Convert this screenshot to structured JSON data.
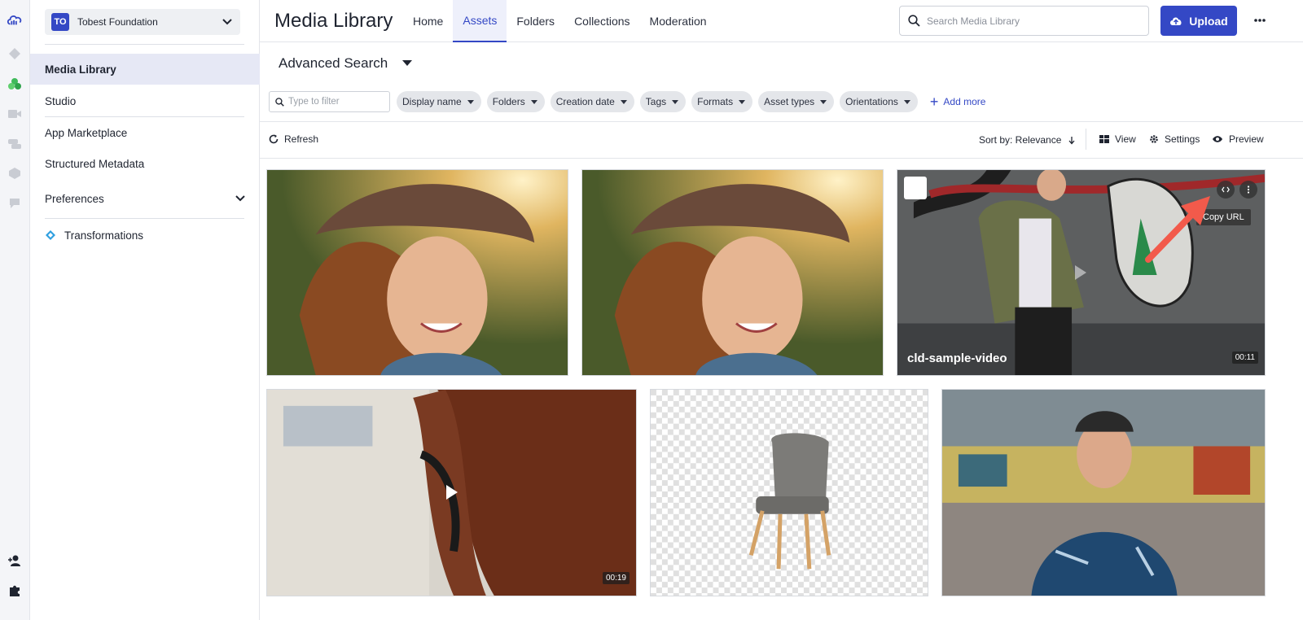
{
  "org": {
    "initials": "TO",
    "name": "Tobest Foundation"
  },
  "sidebar": {
    "items": [
      {
        "label": "Media Library"
      },
      {
        "label": "Studio"
      },
      {
        "label": "App Marketplace"
      },
      {
        "label": "Structured Metadata"
      },
      {
        "label": "Preferences"
      },
      {
        "label": "Transformations"
      }
    ]
  },
  "header": {
    "title": "Media Library",
    "tabs": [
      "Home",
      "Assets",
      "Folders",
      "Collections",
      "Moderation"
    ],
    "search_placeholder": "Search Media Library",
    "upload_label": "Upload"
  },
  "advanced": {
    "label": "Advanced Search",
    "filter_placeholder": "Type to filter",
    "chips": [
      "Display name",
      "Folders",
      "Creation date",
      "Tags",
      "Formats",
      "Asset types",
      "Orientations"
    ],
    "add_more": "Add more"
  },
  "toolbar": {
    "refresh": "Refresh",
    "sort": "Sort by: Relevance",
    "view": "View",
    "settings": "Settings",
    "preview": "Preview"
  },
  "assets": [
    {
      "kind": "image"
    },
    {
      "kind": "image"
    },
    {
      "kind": "video",
      "title": "cld-sample-video",
      "duration": "00:11",
      "tooltip": "Copy URL"
    },
    {
      "kind": "video",
      "duration": "00:19"
    },
    {
      "kind": "image"
    },
    {
      "kind": "image"
    }
  ],
  "colors": {
    "accent": "#3448c5",
    "arrow": "#f25a4b"
  }
}
